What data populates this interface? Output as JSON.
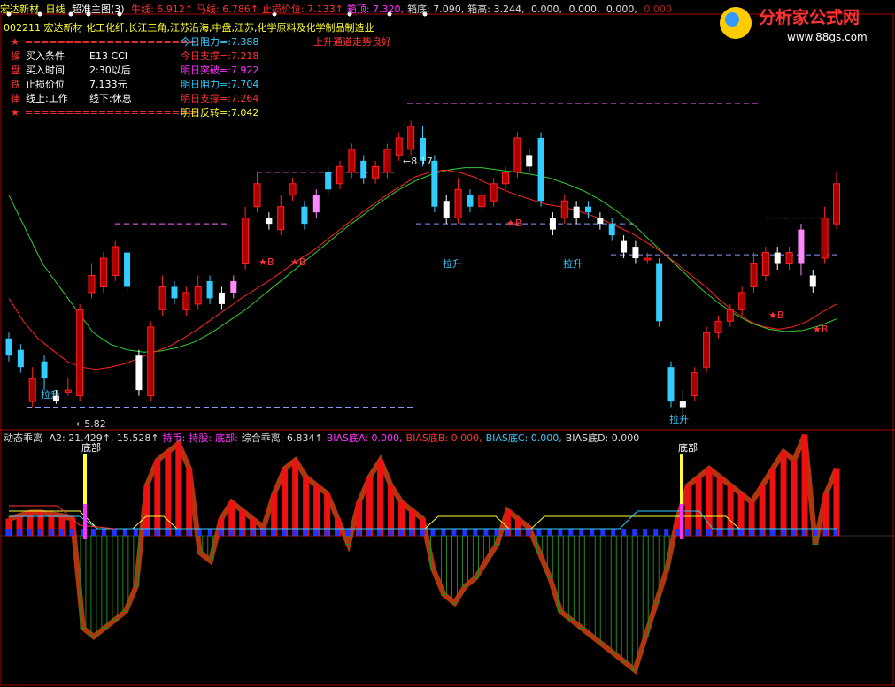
{
  "header": {
    "stock_name": "宏达新材",
    "period": "日线",
    "indicator": "超准主图(3)",
    "items": [
      {
        "label": "牛线:",
        "value": "6.912↑",
        "color": "#ff3030"
      },
      {
        "label": "马线:",
        "value": "6.786↑",
        "color": "#ff3030"
      },
      {
        "label": "止损价位:",
        "value": "7.133↑",
        "color": "#ff3030"
      },
      {
        "label": "箱顶:",
        "value": "7.320,",
        "color": "#ff33ff"
      },
      {
        "label": "箱底:",
        "value": "7.090,",
        "color": "#dddddd"
      },
      {
        "label": "箱高:",
        "value": "3.244,",
        "color": "#dddddd"
      },
      {
        "label": "",
        "value": "0.000,",
        "color": "#dddddd"
      },
      {
        "label": "",
        "value": "0.000,",
        "color": "#dddddd"
      },
      {
        "label": "",
        "value": "0.000,",
        "color": "#dddddd"
      },
      {
        "label": "",
        "value": "0.000",
        "color": "#aa2222"
      }
    ]
  },
  "stock_info": {
    "code_line": "002211 宏达新材 化工化纤,长江三角,江苏沿海,中盘,江苏,化学原料及化学制品制造业",
    "trend_note": "上升通道走势良好",
    "rules": [
      {
        "side": "★",
        "text": "====================="
      },
      {
        "side": "操",
        "text": "买入条件",
        "value": "E13 CCI"
      },
      {
        "side": "盘",
        "text": "买入时间",
        "value": "2:30以后"
      },
      {
        "side": "铁",
        "text": "止损价位",
        "value": "7.133元"
      },
      {
        "side": "律",
        "text": "线上:工作",
        "value": "线下:休息"
      },
      {
        "side": "★",
        "text": "====================="
      }
    ],
    "levels": [
      {
        "label": "今日阻力=:",
        "value": "7.388",
        "color": "#33ccff"
      },
      {
        "label": "今日支撑=:",
        "value": "7.218",
        "color": "#ff3333"
      },
      {
        "label": "明日突破=:",
        "value": "7.922",
        "color": "#ff33ff"
      },
      {
        "label": "明日阻力=:",
        "value": "7.704",
        "color": "#33ccff"
      },
      {
        "label": "明日支撑=:",
        "value": "7.264",
        "color": "#ff3333"
      },
      {
        "label": "明日反转=:",
        "value": "7.042",
        "color": "#ffff33"
      }
    ]
  },
  "lower_header": {
    "title": "动态乖离",
    "items": [
      {
        "text": "A2: 21.429↑, 15.528↑",
        "color": "#dddddd"
      },
      {
        "text": "持币:",
        "color": "#ff33ff"
      },
      {
        "text": "持股:",
        "color": "#ff33ff"
      },
      {
        "text": "底部:",
        "color": "#ff33ff"
      },
      {
        "text": "综合乖离: 6.834↑",
        "color": "#dddddd"
      },
      {
        "text": "BIAS底A: 0.000,",
        "color": "#ff33ff"
      },
      {
        "text": "BIAS底B: 0.000,",
        "color": "#ff3333"
      },
      {
        "text": "BIAS底C: 0.000,",
        "color": "#33ccff"
      },
      {
        "text": "BIAS底D: 0.000",
        "color": "#dddddd"
      }
    ]
  },
  "logo": {
    "title": "分析家公式网",
    "url": "www.88gs.com"
  },
  "colors": {
    "up": "#ff2222",
    "down_cyan": "#33ccff",
    "pink": "#ff88ff",
    "green": "#22aa22",
    "white": "#ffffff",
    "dash_pink": "#ff66ff",
    "dash_blue": "#8899ff",
    "ma_red": "#ff2222",
    "ma_green": "#33cc33"
  },
  "chart_data": {
    "type": "candlestick",
    "annotations": {
      "high_label": "8.17",
      "low_label": "5.82",
      "buy_label": "★B",
      "rise_label": "拉升",
      "bottom_label": "底部"
    },
    "candles": [
      [
        6.4,
        6.55,
        6.6,
        6.35,
        "cyan"
      ],
      [
        6.45,
        6.3,
        6.5,
        6.25,
        "cyan"
      ],
      [
        6.0,
        6.2,
        6.3,
        5.95,
        "up"
      ],
      [
        6.35,
        6.2,
        6.4,
        6.1,
        "cyan"
      ],
      [
        6.05,
        6.0,
        6.1,
        5.98,
        "white"
      ],
      [
        6.1,
        6.08,
        6.2,
        6.05,
        "up"
      ],
      [
        6.05,
        6.8,
        6.85,
        6.0,
        "up"
      ],
      [
        6.95,
        7.1,
        7.2,
        6.9,
        "up"
      ],
      [
        7.0,
        7.25,
        7.3,
        6.95,
        "up"
      ],
      [
        7.1,
        7.35,
        7.4,
        7.05,
        "up"
      ],
      [
        7.3,
        7.0,
        7.4,
        6.95,
        "cyan"
      ],
      [
        6.4,
        6.1,
        6.45,
        6.05,
        "white"
      ],
      [
        6.05,
        6.65,
        6.7,
        6.0,
        "up"
      ],
      [
        6.8,
        7.0,
        7.1,
        6.75,
        "up"
      ],
      [
        7.0,
        6.9,
        7.05,
        6.85,
        "cyan"
      ],
      [
        6.8,
        6.95,
        7.0,
        6.75,
        "up"
      ],
      [
        6.85,
        7.0,
        7.1,
        6.8,
        "up"
      ],
      [
        7.05,
        6.9,
        7.1,
        6.85,
        "cyan"
      ],
      [
        6.95,
        6.85,
        7.0,
        6.8,
        "white"
      ],
      [
        6.95,
        7.05,
        7.1,
        6.9,
        "pink"
      ],
      [
        7.2,
        7.6,
        7.7,
        7.15,
        "up"
      ],
      [
        7.7,
        7.9,
        8.0,
        7.65,
        "up"
      ],
      [
        7.55,
        7.6,
        7.65,
        7.5,
        "white"
      ],
      [
        7.5,
        7.7,
        7.8,
        7.45,
        "up"
      ],
      [
        7.8,
        7.9,
        7.95,
        7.75,
        "up"
      ],
      [
        7.7,
        7.55,
        7.75,
        7.5,
        "cyan"
      ],
      [
        7.65,
        7.8,
        7.85,
        7.6,
        "pink"
      ],
      [
        8.0,
        7.85,
        8.05,
        7.8,
        "cyan"
      ],
      [
        7.9,
        8.05,
        8.1,
        7.85,
        "up"
      ],
      [
        8.0,
        8.2,
        8.25,
        7.95,
        "up"
      ],
      [
        8.1,
        7.95,
        8.15,
        7.9,
        "cyan"
      ],
      [
        7.95,
        8.05,
        8.1,
        7.9,
        "up"
      ],
      [
        8.0,
        8.2,
        8.25,
        7.95,
        "up"
      ],
      [
        8.15,
        8.3,
        8.35,
        8.1,
        "up"
      ],
      [
        8.2,
        8.4,
        8.45,
        8.15,
        "up"
      ],
      [
        8.3,
        8.1,
        8.4,
        8.05,
        "cyan"
      ],
      [
        8.1,
        7.7,
        8.15,
        7.65,
        "cyan"
      ],
      [
        7.75,
        7.6,
        7.8,
        7.55,
        "white"
      ],
      [
        7.6,
        7.85,
        7.95,
        7.55,
        "up"
      ],
      [
        7.8,
        7.7,
        7.85,
        7.65,
        "cyan"
      ],
      [
        7.7,
        7.8,
        7.85,
        7.65,
        "up"
      ],
      [
        7.75,
        7.9,
        7.95,
        7.7,
        "up"
      ],
      [
        7.9,
        8.0,
        8.05,
        7.85,
        "up"
      ],
      [
        8.0,
        8.3,
        8.35,
        7.95,
        "up"
      ],
      [
        8.15,
        8.05,
        8.2,
        8.0,
        "white"
      ],
      [
        8.3,
        7.75,
        8.35,
        7.7,
        "cyan"
      ],
      [
        7.6,
        7.5,
        7.65,
        7.45,
        "white"
      ],
      [
        7.6,
        7.75,
        7.8,
        7.55,
        "up"
      ],
      [
        7.7,
        7.6,
        7.75,
        7.55,
        "white"
      ],
      [
        7.7,
        7.65,
        7.75,
        7.6,
        "cyan"
      ],
      [
        7.6,
        7.55,
        7.65,
        7.5,
        "white"
      ],
      [
        7.55,
        7.45,
        7.6,
        7.4,
        "cyan"
      ],
      [
        7.4,
        7.3,
        7.45,
        7.25,
        "white"
      ],
      [
        7.35,
        7.25,
        7.4,
        7.2,
        "white"
      ],
      [
        7.25,
        7.25,
        7.3,
        7.2,
        "up"
      ],
      [
        7.2,
        6.7,
        7.25,
        6.65,
        "cyan"
      ],
      [
        6.3,
        6.0,
        6.35,
        5.95,
        "cyan"
      ],
      [
        6.0,
        5.95,
        6.1,
        5.85,
        "white"
      ],
      [
        6.05,
        6.25,
        6.3,
        6.0,
        "up"
      ],
      [
        6.3,
        6.6,
        6.65,
        6.25,
        "up"
      ],
      [
        6.6,
        6.7,
        6.75,
        6.55,
        "up"
      ],
      [
        6.7,
        6.8,
        6.85,
        6.65,
        "up"
      ],
      [
        6.8,
        6.95,
        7.0,
        6.75,
        "up"
      ],
      [
        7.0,
        7.2,
        7.3,
        6.95,
        "up"
      ],
      [
        7.1,
        7.3,
        7.35,
        7.05,
        "up"
      ],
      [
        7.3,
        7.2,
        7.35,
        7.15,
        "white"
      ],
      [
        7.2,
        7.3,
        7.35,
        7.15,
        "up"
      ],
      [
        7.5,
        7.2,
        7.55,
        7.1,
        "pink"
      ],
      [
        7.0,
        7.1,
        7.15,
        6.95,
        "white"
      ],
      [
        7.25,
        7.6,
        7.7,
        7.2,
        "up"
      ],
      [
        7.55,
        7.9,
        8.0,
        7.5,
        "up"
      ]
    ],
    "ma_red": [
      6.9,
      6.7,
      6.55,
      6.45,
      6.35,
      6.3,
      6.28,
      6.3,
      6.33,
      6.38,
      6.43,
      6.48,
      6.55,
      6.63,
      6.72,
      6.81,
      6.9,
      6.98,
      7.06,
      7.15,
      7.24,
      7.32,
      7.42,
      7.52,
      7.62,
      7.71,
      7.8,
      7.88,
      7.96,
      8.0,
      8.02,
      8.0,
      7.96,
      7.9,
      7.85,
      7.8,
      7.76,
      7.72,
      7.7,
      7.67,
      7.63,
      7.58,
      7.52,
      7.46,
      7.38,
      7.3,
      7.2,
      7.1,
      7.0,
      6.88,
      6.78,
      6.7,
      6.65,
      6.63,
      6.65,
      6.7,
      6.78,
      6.85
    ],
    "ma_green": [
      7.8,
      7.5,
      7.2,
      7.0,
      6.8,
      6.6,
      6.5,
      6.45,
      6.43,
      6.44,
      6.47,
      6.52,
      6.6,
      6.7,
      6.8,
      6.92,
      7.04,
      7.16,
      7.28,
      7.4,
      7.52,
      7.63,
      7.74,
      7.84,
      7.92,
      7.98,
      8.02,
      8.04,
      8.04,
      8.02,
      8.0,
      7.98,
      7.95,
      7.9,
      7.84,
      7.76,
      7.66,
      7.54,
      7.4,
      7.26,
      7.12,
      6.98,
      6.86,
      6.76,
      6.68,
      6.63,
      6.61,
      6.62,
      6.66,
      6.72
    ],
    "lower": {
      "bars": [
        10,
        12,
        14,
        14,
        13,
        12,
        10,
        -55,
        -60,
        -55,
        -50,
        -45,
        -30,
        30,
        45,
        50,
        55,
        40,
        -10,
        -15,
        10,
        20,
        15,
        10,
        5,
        25,
        40,
        45,
        35,
        30,
        25,
        10,
        -5,
        20,
        35,
        45,
        30,
        20,
        15,
        10,
        -20,
        -35,
        -40,
        -30,
        -25,
        -15,
        -5,
        15,
        10,
        5,
        -10,
        -25,
        -45,
        -50,
        -55,
        -60,
        -65,
        -70,
        -75,
        -80,
        -60,
        -40,
        -20,
        10,
        30,
        35,
        40,
        35,
        30,
        25,
        20,
        30,
        40,
        50,
        45,
        60,
        -5,
        25,
        40
      ]
    }
  }
}
